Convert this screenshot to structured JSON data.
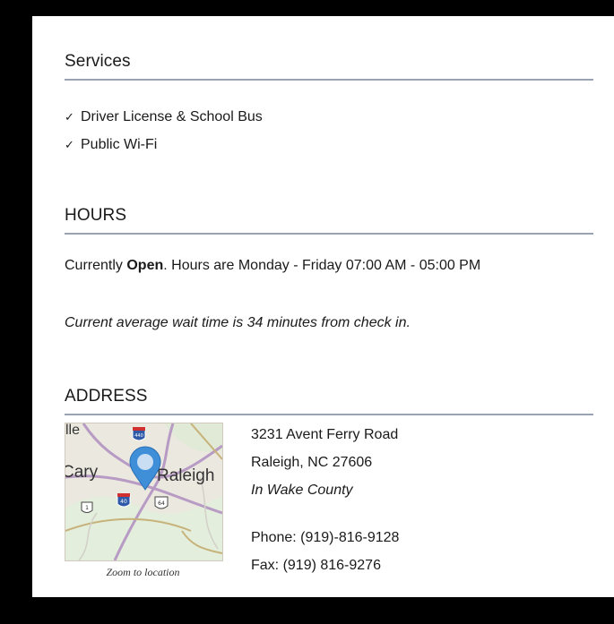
{
  "services": {
    "title": "Services",
    "items": [
      {
        "check": "✓",
        "label": "Driver License & School Bus"
      },
      {
        "check": "✓",
        "label": "Public Wi-Fi"
      }
    ]
  },
  "hours": {
    "title": "HOURS",
    "status_prefix": "Currently ",
    "status_value": "Open",
    "status_suffix": ". Hours are Monday - Friday 07:00 AM - 05:00 PM",
    "wait_text": "Current average wait time is 34 minutes from check in."
  },
  "address": {
    "title": "ADDRESS",
    "street": "3231 Avent Ferry Road",
    "city": "Raleigh, NC 27606",
    "county": "In Wake County",
    "phone": "Phone: (919)-816-9128",
    "fax": "Fax: (919) 816-9276",
    "map": {
      "caption": "Zoom to location",
      "label_left_edge": "lle",
      "label_cary": "Cary",
      "label_raleigh": "Raleigh",
      "shield_440": "440",
      "shield_40": "40",
      "shield_64": "64",
      "shield_1": "1"
    }
  },
  "colors": {
    "divider": "#9aa3b2",
    "pin": "#3f8fd8",
    "frame": "#000000"
  }
}
